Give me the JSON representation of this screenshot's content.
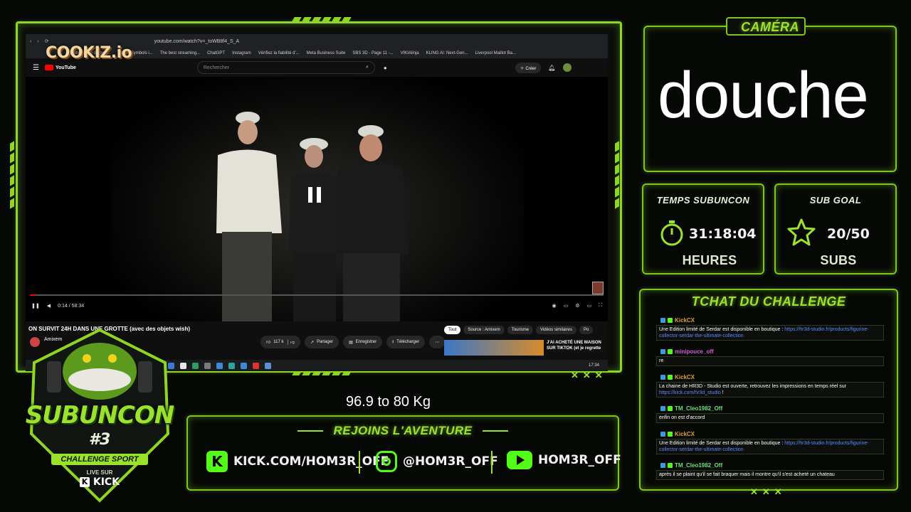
{
  "camera": {
    "title": "CAMÉRA",
    "overlay_text": "douche"
  },
  "subathon_timer": {
    "title": "TEMPS SUBUNCON",
    "value": "31:18:04",
    "unit": "HEURES"
  },
  "sub_goal": {
    "title": "SUB GOAL",
    "value": "20/50",
    "unit": "SUBS"
  },
  "chat": {
    "title": "TCHAT DU CHALLENGE",
    "messages": [
      {
        "user": "KickCX",
        "user_color": "#e0a22a",
        "text": "Une Edition limité de Serdar est disponible en boutique : ",
        "link": "https://hr3d-studio.fr/products/figurine-collector-serdar-the-ultimate-collection"
      },
      {
        "user": "minipouce_off",
        "user_color": "#d65fd6",
        "text": "re",
        "link": ""
      },
      {
        "user": "KickCX",
        "user_color": "#e0a22a",
        "text": "La chaine de HR3D - Studio est ouverte, retrouvez les impressions en temps réel sur ",
        "link": "https://kick.com/hr3d_studio",
        "suffix": " !"
      },
      {
        "user": "TM_Cleo1982_Off",
        "user_color": "#6fe07a",
        "text": "enfin on est d'accord",
        "link": ""
      },
      {
        "user": "KickCX",
        "user_color": "#e0a22a",
        "text": "Une Edition limité de Serdar est disponible en boutique : ",
        "link": "https://hr3d-studio.fr/products/figurine-collector-serdar-the-ultimate-collection"
      },
      {
        "user": "TM_Cleo1982_Off",
        "user_color": "#6fe07a",
        "text": "après il se plaint qu'il se fait braquer mais il montre qu'il s'est acheté un chateau",
        "link": ""
      }
    ]
  },
  "weight_caption": "96.9 to 80 Kg",
  "join": {
    "title": "REJOINS L'AVENTURE",
    "kick": "KICK.COM/HOM3R_OFF",
    "instagram": "@HOM3R_OFF",
    "youtube": "HOM3R_OFF"
  },
  "logo": {
    "line1": "SUBUNCON",
    "line2": "#3",
    "line3": "CHALLENGE SPORT",
    "line4": "LIVE SUR",
    "line5": "KICK"
  },
  "cookiz": "COOKIZ.io",
  "browser": {
    "url": "youtube.com/watch?v=_toWB8f4_S_A",
    "bookmarks": [
      "Gestionnaire de poli...",
      "Twitter Symbols i...",
      "The best streaming...",
      "ChatGPT",
      "Instagram",
      "Vérifiez la fiabilité d'...",
      "Meta Business Suite",
      "SBS 3D - Page 11 -...",
      "VIKIAlinja",
      "KLING AI: Next-Gen...",
      "Liverpool Maillot Ba..."
    ],
    "youtube_label": "YouTube",
    "search_placeholder": "Rechercher",
    "create_label": "Créer",
    "time": "0:14 / 58:34",
    "video_title": "ON SURVIT 24H DANS UNE GROTTE (avec des objets wish)",
    "channel": "Amixem",
    "likes": "117 k",
    "share": "Partager",
    "save": "Enregistrer",
    "download": "Télécharger",
    "chips": [
      "Tout",
      "Source : Amixem",
      "Tourisme",
      "Vidéos similaires",
      "Po"
    ],
    "suggested_title": "J'AI ACHETÉ UNE MAISON SUR TIKTOK (et je regrette",
    "clock": "17:34"
  }
}
